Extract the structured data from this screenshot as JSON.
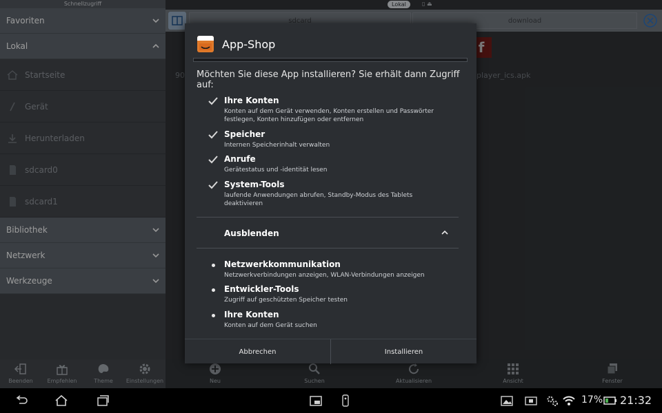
{
  "sidebar": {
    "title": "Schnellzugriff",
    "sections": {
      "favoriten": "Favoriten",
      "lokal": "Lokal",
      "bibliothek": "Bibliothek",
      "netzwerk": "Netzwerk",
      "werkzeuge": "Werkzeuge"
    },
    "items": [
      {
        "label": "Startseite",
        "icon": "home-icon"
      },
      {
        "label": "Gerät",
        "icon": "slash-icon"
      },
      {
        "label": "Herunterladen",
        "icon": "download-icon"
      },
      {
        "label": "sdcard0",
        "icon": "sdcard-icon"
      },
      {
        "label": "sdcard1",
        "icon": "sdcard-icon"
      }
    ]
  },
  "main": {
    "tab_label": "Lokal",
    "path_segments": [
      "sdcard",
      "download"
    ],
    "file_left_fragment": "90",
    "file_right_fragment": "player_ics.apk"
  },
  "dialog": {
    "title": "App-Shop",
    "prompt": "Möchten Sie diese App installieren? Sie erhält dann Zugriff auf:",
    "permissions": [
      {
        "title": "Ihre Konten",
        "desc": "Konten auf dem Gerät verwenden, Konten erstellen und Passwörter festlegen, Konten hinzufügen oder entfernen"
      },
      {
        "title": "Speicher",
        "desc": "Internen Speicherinhalt verwalten"
      },
      {
        "title": "Anrufe",
        "desc": "Gerätestatus und -identität lesen"
      },
      {
        "title": "System-Tools",
        "desc": "laufende Anwendungen abrufen, Standby-Modus des Tablets deaktivieren"
      }
    ],
    "collapse_label": "Ausblenden",
    "extra_permissions": [
      {
        "title": "Netzwerkkommunikation",
        "desc": "Netzwerkverbindungen anzeigen, WLAN-Verbindungen anzeigen"
      },
      {
        "title": "Entwickler-Tools",
        "desc": "Zugriff auf geschützten Speicher testen"
      },
      {
        "title": "Ihre Konten",
        "desc": "Konten auf dem Gerät suchen"
      }
    ],
    "cancel_label": "Abbrechen",
    "install_label": "Installieren"
  },
  "toolbar": {
    "beenden": "Beenden",
    "empfehlen": "Empfehlen",
    "theme": "Theme",
    "einstellungen": "Einstellungen",
    "neu": "Neu",
    "suchen": "Suchen",
    "aktualisieren": "Aktualisieren",
    "ansicht": "Ansicht",
    "fenster": "Fenster"
  },
  "statusbar": {
    "battery": "17%",
    "time": "21:32"
  }
}
